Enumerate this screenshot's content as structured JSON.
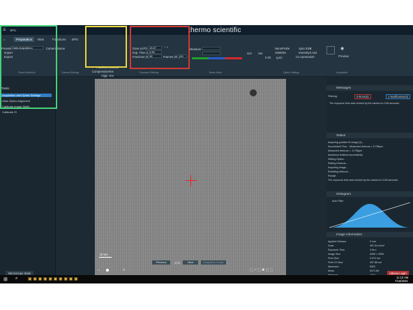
{
  "app": {
    "title": "EPU",
    "brand": "thermo scientific"
  },
  "tabs": [
    "Preparation",
    "Atlas",
    "Functions",
    "EPU"
  ],
  "preset": {
    "label": "Presets:",
    "value": "Data Acquisition",
    "camera": "Camera Name",
    "import": "Import",
    "export": "Export",
    "group": "Preset Selection"
  },
  "camera": {
    "fraction_label": "Fractions",
    "fraction_value": "Manual",
    "compression_label": "Compression",
    "compression_value": "Yes",
    "align_label": "Align",
    "align_value": "Yes",
    "group": "Camera Settings"
  },
  "exposure": {
    "dose_label": "Dose (e/Å²)",
    "dose_value": "15.67",
    "exp_label": "Exp. Time (s)",
    "exp_value": "3.89",
    "frac_label": "Fractions (#)",
    "frac_value": "38",
    "frames_label": "Frames (#/s)",
    "frames_value": "100",
    "group": "Exposure Settings"
  },
  "optics": {
    "measure": "Measure",
    "nanoprobe": "NanoProbe",
    "mag": "150000x",
    "spot": "Spot Size",
    "spot_value": "3",
    "intensity": "Intensity",
    "intensity_value": "0.444",
    "c2": "C2 Aperture",
    "c2_value": "20",
    "defocus_label": "(µm)",
    "defocus_value": "0.00",
    "get": "Get",
    "set": "Set",
    "group": "Optics Settings",
    "beam": "Beam Node"
  },
  "acquisition": {
    "preview": "Preview",
    "group": "Acquisition"
  },
  "tasks": {
    "header": "Tasks",
    "items": [
      "Acquisition and Optics Settings",
      "Atlas Optics Alignment",
      "Calibrate Image Shifts",
      "Calibrate IS"
    ]
  },
  "image": {
    "scalebar": "20 nm"
  },
  "nav": {
    "previous": "Previous",
    "page": "3/45",
    "next": "Next",
    "integration": "Integration Image"
  },
  "messages": {
    "title": "Messages",
    "filtering": "Filtering:",
    "errors": "0 Error(s)",
    "notifications": "1 Notification(s)",
    "text": "The exposure time was revised by the camera to 3.89 seconds."
  },
  "status": {
    "title": "Status",
    "lines": [
      "Acquiring positive ID image [1]...",
      "Succeeded! Fine... Measured defocus = 5.758µm",
      "Measured defocus = -5.758µm",
      "Autofocus finished successfully.",
      "Setting Optics...",
      "Setting Defocus...",
      "Acquiring image...",
      "Resetting defocus...",
      "Ready!",
      "The exposure time was revised by the camera to 3.89 seconds."
    ]
  },
  "histogram": {
    "title": "Histogram",
    "auto": "Auto Filter"
  },
  "info": {
    "title": "Image Information",
    "rows": [
      [
        "Applied Defocus",
        "0 mm"
      ],
      [
        "Dose",
        "387.54 e/nm²"
      ],
      [
        "Exposure Time",
        "3.9s s"
      ],
      [
        "Image Size",
        "4096 × 4096"
      ],
      [
        "Pixel Size",
        "0.974 nm"
      ],
      [
        "Field Of View",
        "397.88 nm"
      ],
      [
        "Maximum",
        "5520"
      ],
      [
        "Mean",
        "5471.66"
      ],
      [
        "Minimum",
        "1421"
      ]
    ]
  },
  "footer": {
    "microscope": "Microscope State",
    "user": "Athena Login"
  },
  "clock": {
    "time": "11:10 AM",
    "date": "7/16/2024"
  }
}
